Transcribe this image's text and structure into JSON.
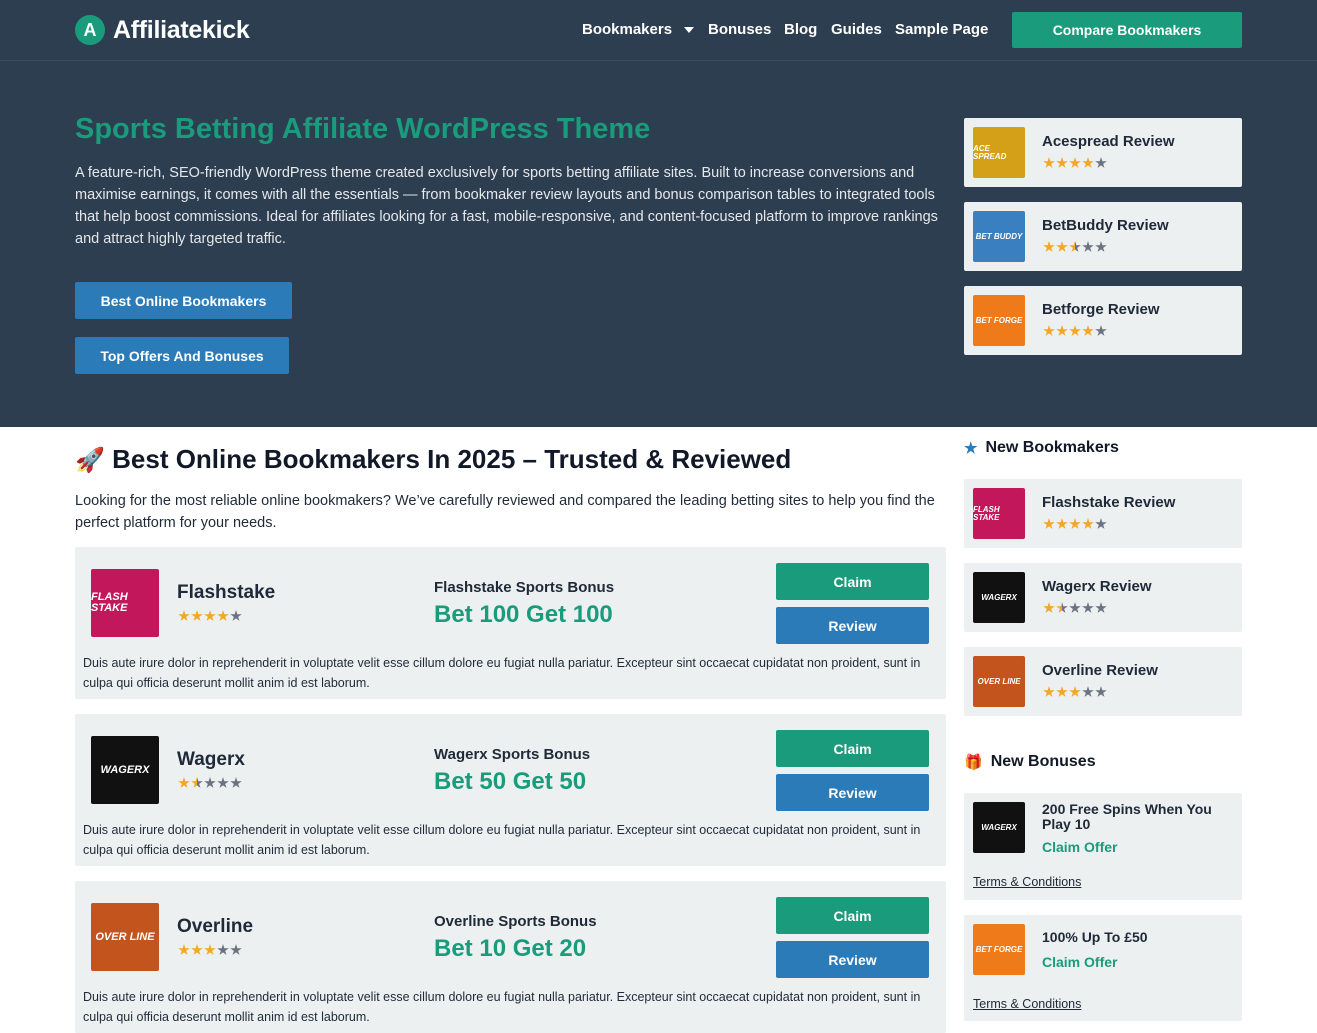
{
  "header": {
    "logo_letter": "A",
    "logo_text": "Affiliatekick",
    "nav": [
      "Bookmakers",
      "Bonuses",
      "Blog",
      "Guides",
      "Sample Page"
    ],
    "cta": "Compare Bookmakers"
  },
  "hero": {
    "title": "Sports Betting Affiliate WordPress Theme",
    "description": "A feature-rich, SEO-friendly WordPress theme created exclusively for sports betting affiliate sites. Built to increase conversions and maximise earnings, it comes with all the essentials — from bookmaker review layouts and bonus comparison tables to integrated tools that help boost commissions. Ideal for affiliates looking for a fast, mobile-responsive, and content-focused platform to improve rankings and attract highly targeted traffic.",
    "btn_primary": "Best Online Bookmakers",
    "btn_secondary": "Top Offers And Bonuses"
  },
  "hero_reviews": [
    {
      "title": "Acespread Review",
      "logo": "ACE SPREAD",
      "color": "#d4a017",
      "rating": 4
    },
    {
      "title": "BetBuddy Review",
      "logo": "BET BUDDY",
      "color": "#3a7fbf",
      "rating": 2.5
    },
    {
      "title": "Betforge Review",
      "logo": "BET FORGE",
      "color": "#ee7a1a",
      "rating": 4
    }
  ],
  "main": {
    "title": "Best Online Bookmakers In 2025 – Trusted & Reviewed",
    "title_emoji": "🚀",
    "description": "Looking for the most reliable online bookmakers? We’ve carefully reviewed and compared the leading betting sites to help you find the perfect platform for your needs."
  },
  "bookmakers": [
    {
      "name": "Flashstake",
      "logo": "FLASH STAKE",
      "color": "#c2185b",
      "rating": 4,
      "bonus_label": "Flashstake Sports Bonus",
      "bonus": "Bet 100 Get 100",
      "claim": "Claim",
      "review": "Review",
      "text": "Duis aute irure dolor in reprehenderit in voluptate velit esse cillum dolore eu fugiat nulla pariatur. Excepteur sint occaecat cupidatat non proident, sunt in culpa qui officia deserunt mollit anim id est laborum."
    },
    {
      "name": "Wagerx",
      "logo": "WAGERX",
      "color": "#111111",
      "rating": 1.5,
      "bonus_label": "Wagerx Sports Bonus",
      "bonus": "Bet 50 Get 50",
      "claim": "Claim",
      "review": "Review",
      "text": "Duis aute irure dolor in reprehenderit in voluptate velit esse cillum dolore eu fugiat nulla pariatur. Excepteur sint occaecat cupidatat non proident, sunt in culpa qui officia deserunt mollit anim id est laborum."
    },
    {
      "name": "Overline",
      "logo": "OVER LINE",
      "color": "#c4541e",
      "rating": 3,
      "bonus_label": "Overline Sports Bonus",
      "bonus": "Bet 10 Get 20",
      "claim": "Claim",
      "review": "Review",
      "text": "Duis aute irure dolor in reprehenderit in voluptate velit esse cillum dolore eu fugiat nulla pariatur. Excepteur sint occaecat cupidatat non proident, sunt in culpa qui officia deserunt mollit anim id est laborum."
    }
  ],
  "sidebar": {
    "new_bookmakers_title": "New Bookmakers",
    "new_bookmakers": [
      {
        "title": "Flashstake Review",
        "logo": "FLASH STAKE",
        "color": "#c2185b",
        "rating": 4
      },
      {
        "title": "Wagerx Review",
        "logo": "WAGERX",
        "color": "#111111",
        "rating": 1.5
      },
      {
        "title": "Overline Review",
        "logo": "OVER LINE",
        "color": "#c4541e",
        "rating": 3
      }
    ],
    "new_bonuses_title": "New Bonuses",
    "new_bonuses": [
      {
        "title": "200 Free Spins When You Play 10",
        "logo": "WAGERX",
        "color": "#111111",
        "claim": "Claim Offer",
        "terms": "Terms & Conditions"
      },
      {
        "title": "100% Up To £50",
        "logo": "BET FORGE",
        "color": "#ee7a1a",
        "claim": "Claim Offer",
        "terms": "Terms & Conditions"
      }
    ]
  }
}
